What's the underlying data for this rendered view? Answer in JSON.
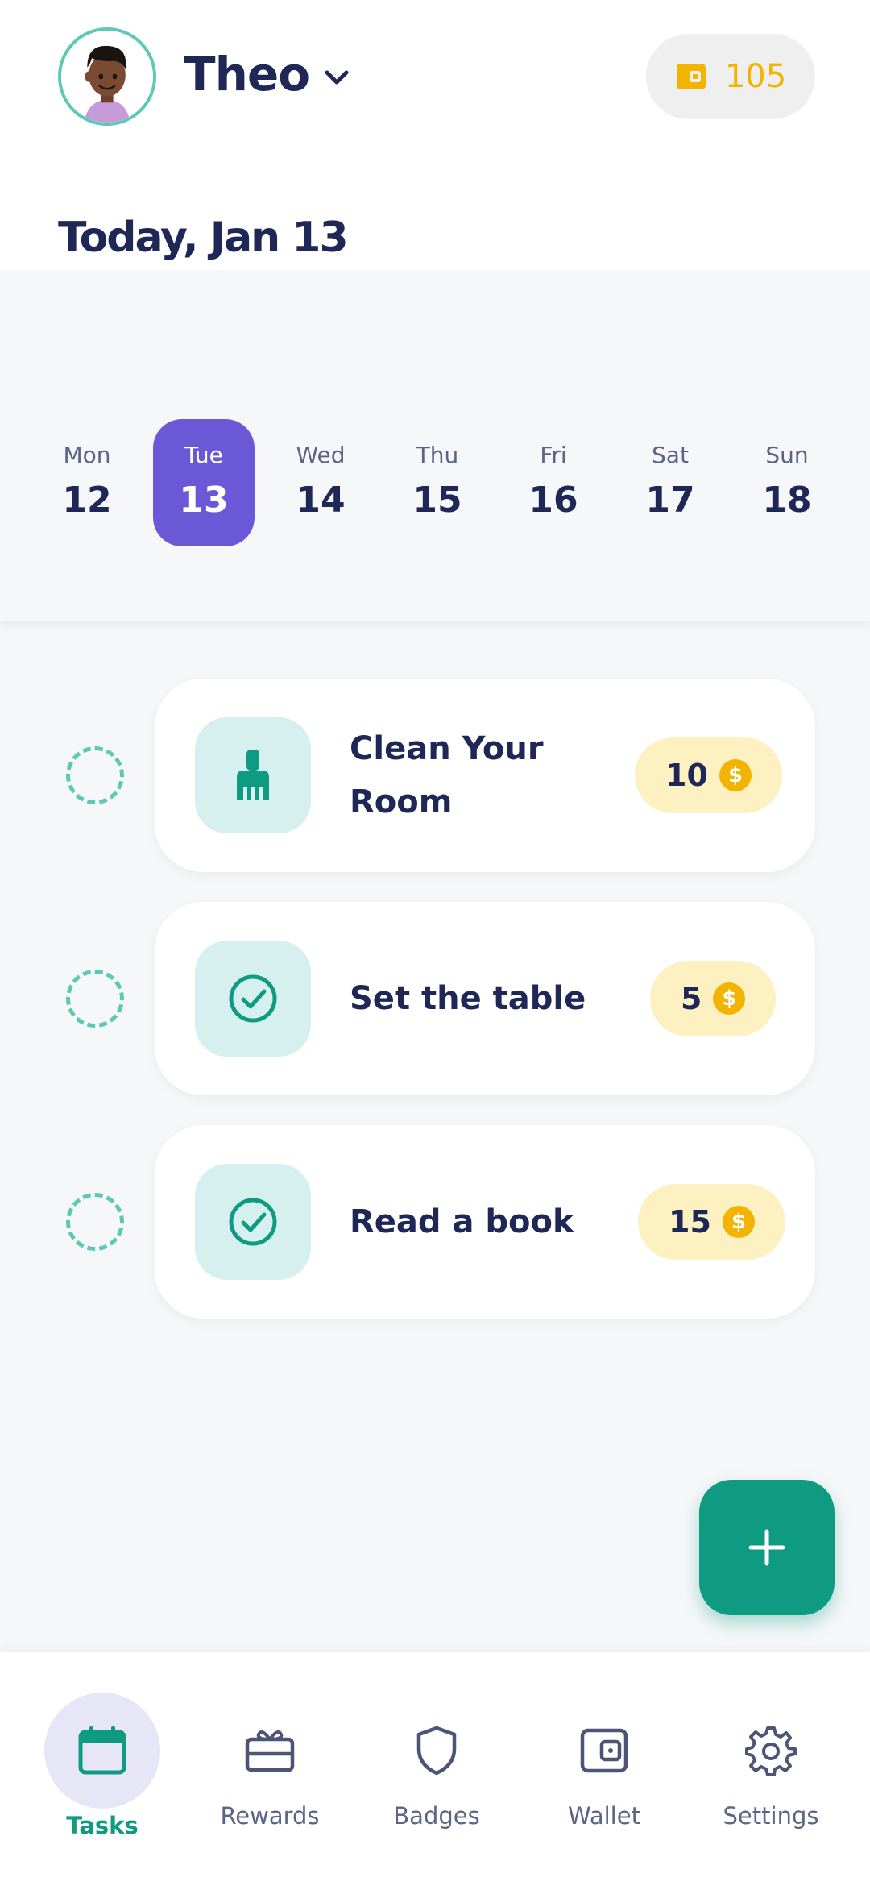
{
  "header": {
    "user_name": "Theo",
    "balance": "105",
    "date_title": "Today, Jan 13"
  },
  "week": [
    {
      "day": "Mon",
      "num": "12",
      "selected": false
    },
    {
      "day": "Tue",
      "num": "13",
      "selected": true
    },
    {
      "day": "Wed",
      "num": "14",
      "selected": false
    },
    {
      "day": "Thu",
      "num": "15",
      "selected": false
    },
    {
      "day": "Fri",
      "num": "16",
      "selected": false
    },
    {
      "day": "Sat",
      "num": "17",
      "selected": false
    },
    {
      "day": "Sun",
      "num": "18",
      "selected": false
    }
  ],
  "tasks": [
    {
      "title": "Clean Your Room",
      "points": "10",
      "icon": "broom-icon"
    },
    {
      "title": "Set the table",
      "points": "5",
      "icon": "check-circle-icon"
    },
    {
      "title": "Read a book",
      "points": "15",
      "icon": "check-circle-icon"
    }
  ],
  "nav": {
    "tasks": "Tasks",
    "rewards": "Rewards",
    "badges": "Badges",
    "wallet": "Wallet",
    "settings": "Settings"
  },
  "colors": {
    "primary": "#0f9a82",
    "selected_day": "#6b58d6",
    "coin": "#f2b400",
    "text": "#1f2757"
  }
}
